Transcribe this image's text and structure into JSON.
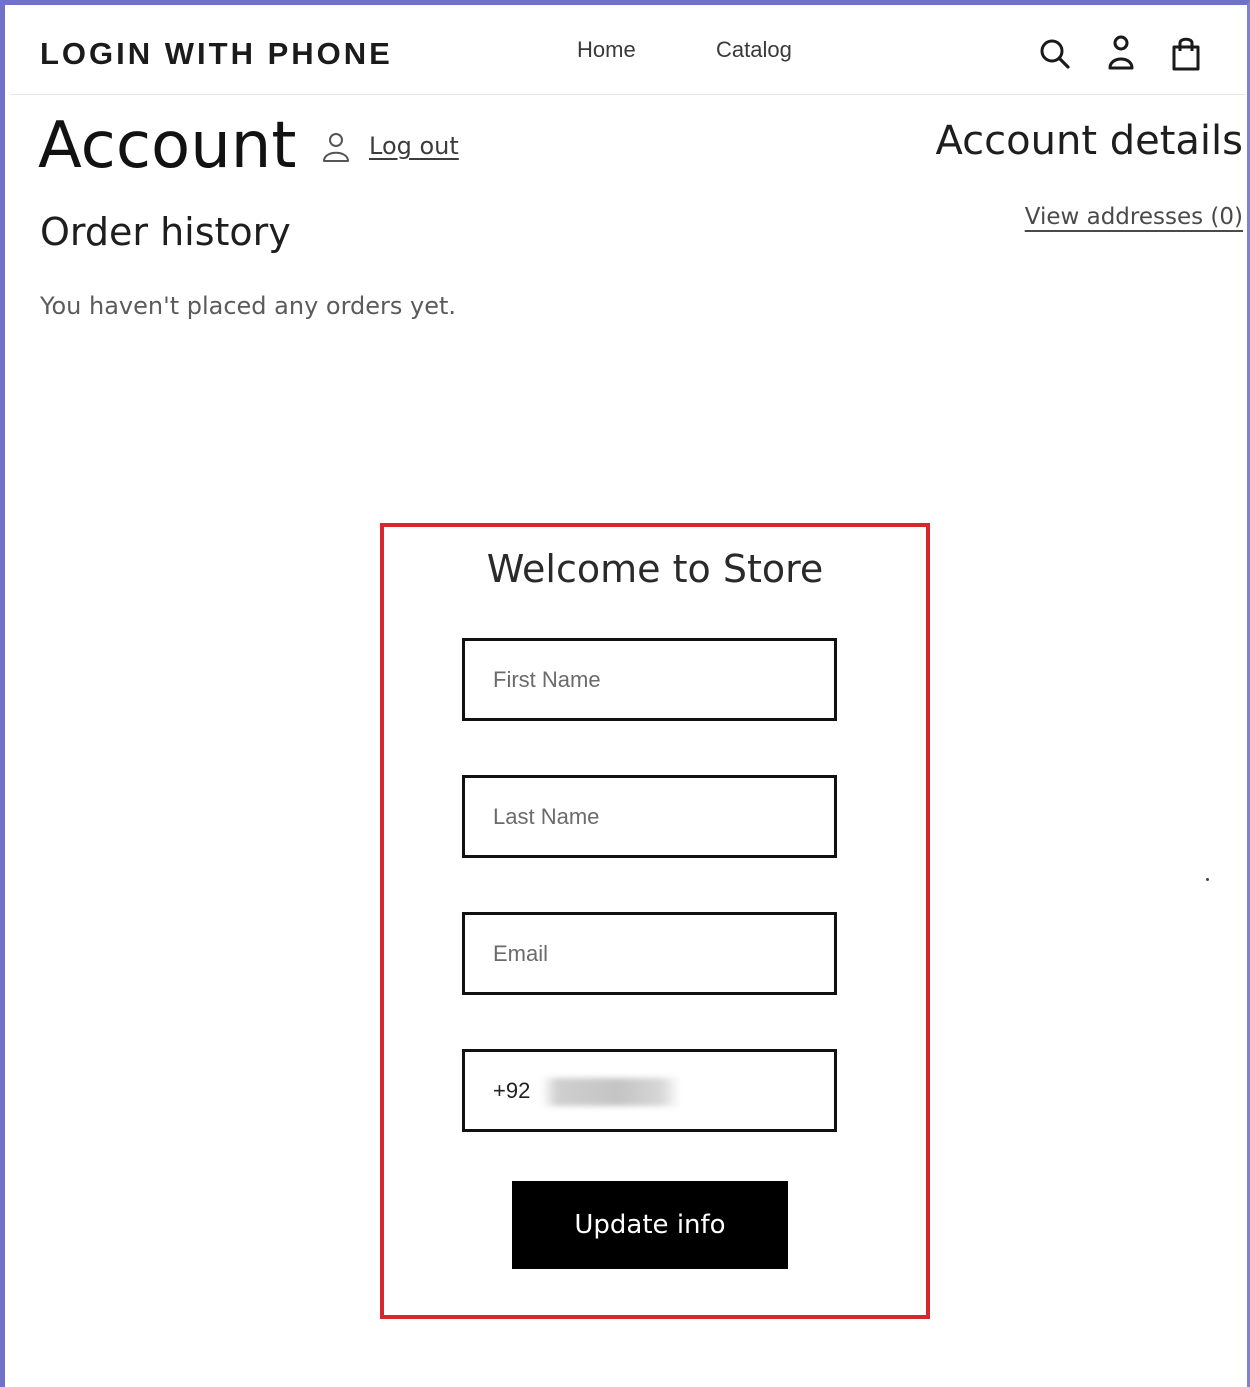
{
  "header": {
    "brand": "LOGIN WITH PHONE",
    "nav": {
      "home": "Home",
      "catalog": "Catalog"
    },
    "icons": [
      "search-icon",
      "account-icon",
      "cart-icon"
    ]
  },
  "account": {
    "title": "Account",
    "logout_label": "Log out",
    "details_title": "Account details",
    "view_addresses": "View addresses (0)"
  },
  "orders": {
    "title": "Order history",
    "empty_message": "You haven't placed any orders yet."
  },
  "form": {
    "title": "Welcome to Store",
    "first_name_placeholder": "First Name",
    "last_name_placeholder": "Last Name",
    "email_placeholder": "Email",
    "phone_value": "+92",
    "submit_label": "Update info",
    "border_color": "#d7262f"
  }
}
